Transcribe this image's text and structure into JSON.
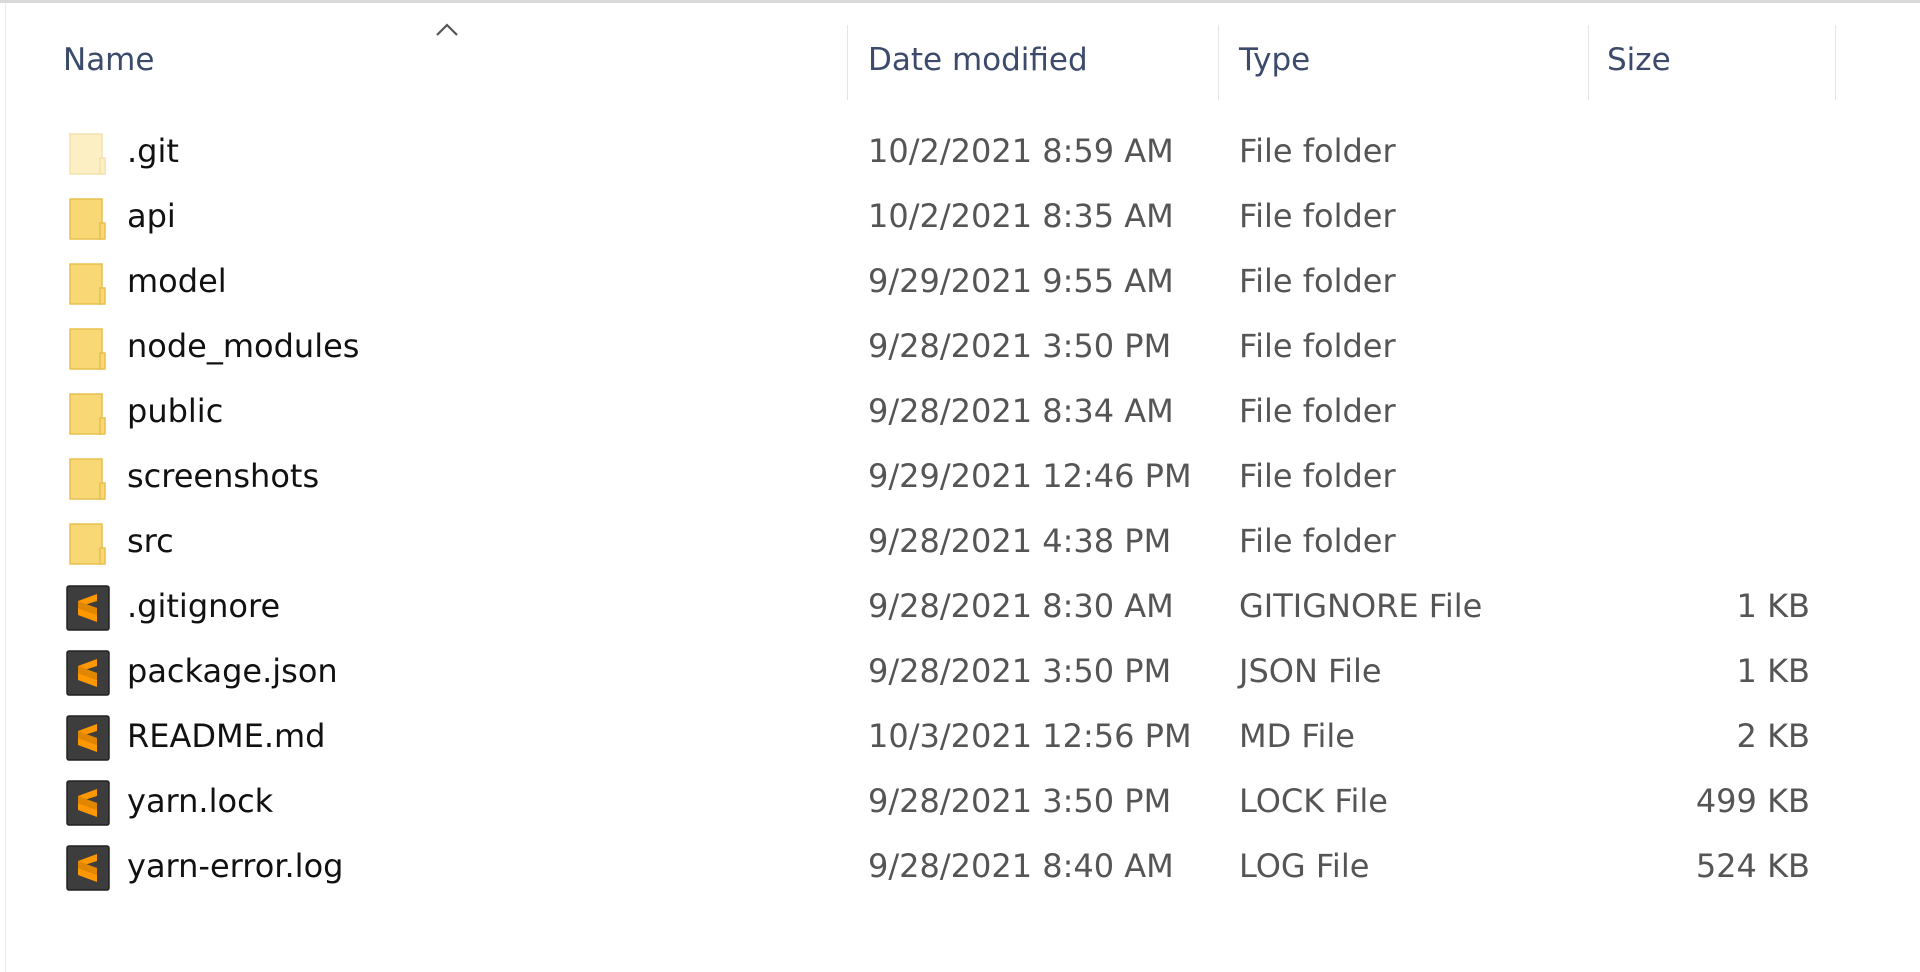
{
  "columns": {
    "name": "Name",
    "date": "Date modified",
    "type": "Type",
    "size": "Size"
  },
  "sort": {
    "column": "name",
    "direction": "ascending",
    "icon": "chevron-up-icon"
  },
  "colors": {
    "folder": "#f8d775",
    "folder_hidden": "#fcefc4",
    "sublime_bg": "#3d3d3d",
    "sublime_accent": "#ff9800",
    "header_text": "#3c4a6b"
  },
  "files": [
    {
      "name": ".git",
      "date": "10/2/2021 8:59 AM",
      "type": "File folder",
      "size": "",
      "icon": "folder-hidden"
    },
    {
      "name": "api",
      "date": "10/2/2021 8:35 AM",
      "type": "File folder",
      "size": "",
      "icon": "folder"
    },
    {
      "name": "model",
      "date": "9/29/2021 9:55 AM",
      "type": "File folder",
      "size": "",
      "icon": "folder"
    },
    {
      "name": "node_modules",
      "date": "9/28/2021 3:50 PM",
      "type": "File folder",
      "size": "",
      "icon": "folder"
    },
    {
      "name": "public",
      "date": "9/28/2021 8:34 AM",
      "type": "File folder",
      "size": "",
      "icon": "folder"
    },
    {
      "name": "screenshots",
      "date": "9/29/2021 12:46 PM",
      "type": "File folder",
      "size": "",
      "icon": "folder"
    },
    {
      "name": "src",
      "date": "9/28/2021 4:38 PM",
      "type": "File folder",
      "size": "",
      "icon": "folder"
    },
    {
      "name": ".gitignore",
      "date": "9/28/2021 8:30 AM",
      "type": "GITIGNORE File",
      "size": "1 KB",
      "icon": "sublime-file"
    },
    {
      "name": "package.json",
      "date": "9/28/2021 3:50 PM",
      "type": "JSON File",
      "size": "1 KB",
      "icon": "sublime-file"
    },
    {
      "name": "README.md",
      "date": "10/3/2021 12:56 PM",
      "type": "MD File",
      "size": "2 KB",
      "icon": "sublime-file"
    },
    {
      "name": "yarn.lock",
      "date": "9/28/2021 3:50 PM",
      "type": "LOCK File",
      "size": "499 KB",
      "icon": "sublime-file"
    },
    {
      "name": "yarn-error.log",
      "date": "9/28/2021 8:40 AM",
      "type": "LOG File",
      "size": "524 KB",
      "icon": "sublime-file"
    }
  ]
}
